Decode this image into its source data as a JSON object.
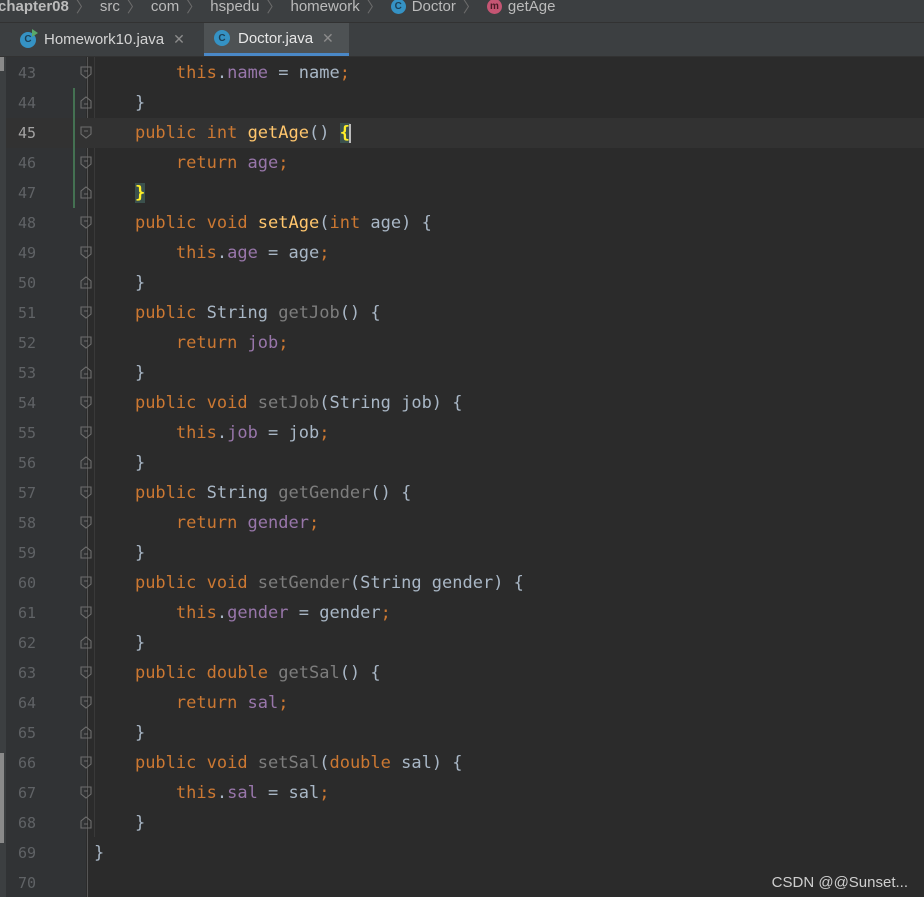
{
  "breadcrumb": {
    "items": [
      {
        "label": "chapter08",
        "icon": null
      },
      {
        "label": "src",
        "icon": null
      },
      {
        "label": "com",
        "icon": null
      },
      {
        "label": "hspedu",
        "icon": null
      },
      {
        "label": "homework",
        "icon": null
      },
      {
        "label": "Doctor",
        "icon": "class-c"
      },
      {
        "label": "getAge",
        "icon": "method-m"
      }
    ]
  },
  "tabs": [
    {
      "label": "Homework10.java",
      "icon": "class-runnable-icon",
      "active": false
    },
    {
      "label": "Doctor.java",
      "icon": "class-icon",
      "active": true
    }
  ],
  "editor": {
    "current_line": 45,
    "lines": [
      {
        "n": "43",
        "tokens": [
          [
            "        ",
            "pl"
          ],
          [
            "this",
            "kw"
          ],
          [
            ".",
            "pl"
          ],
          [
            "name",
            "fld"
          ],
          [
            " = name",
            "pl"
          ],
          [
            ";",
            "kw"
          ]
        ]
      },
      {
        "n": "44",
        "tokens": [
          [
            "    }",
            "pl"
          ]
        ]
      },
      {
        "n": "45",
        "tokens": [
          [
            "    ",
            "pl"
          ],
          [
            "public ",
            "kw"
          ],
          [
            "int ",
            "kw"
          ],
          [
            "getAge",
            "mth"
          ],
          [
            "() ",
            "pl"
          ],
          [
            "{",
            "brace-hl"
          ]
        ]
      },
      {
        "n": "46",
        "tokens": [
          [
            "        ",
            "pl"
          ],
          [
            "return ",
            "kw"
          ],
          [
            "age",
            "fld"
          ],
          [
            ";",
            "kw"
          ]
        ]
      },
      {
        "n": "47",
        "tokens": [
          [
            "    ",
            "pl"
          ],
          [
            "}",
            "brace-hl"
          ]
        ]
      },
      {
        "n": "48",
        "tokens": [
          [
            "    ",
            "pl"
          ],
          [
            "public ",
            "kw"
          ],
          [
            "void ",
            "kw"
          ],
          [
            "setAge",
            "mth"
          ],
          [
            "(",
            "pl"
          ],
          [
            "int ",
            "kw"
          ],
          [
            "age) {",
            "pl"
          ]
        ]
      },
      {
        "n": "49",
        "tokens": [
          [
            "        ",
            "pl"
          ],
          [
            "this",
            "kw"
          ],
          [
            ".",
            "pl"
          ],
          [
            "age",
            "fld"
          ],
          [
            " = age",
            "pl"
          ],
          [
            ";",
            "kw"
          ]
        ]
      },
      {
        "n": "50",
        "tokens": [
          [
            "    }",
            "pl"
          ]
        ]
      },
      {
        "n": "51",
        "tokens": [
          [
            "    ",
            "pl"
          ],
          [
            "public ",
            "kw"
          ],
          [
            "String ",
            "pl"
          ],
          [
            "getJob",
            "mth-dim"
          ],
          [
            "() {",
            "pl"
          ]
        ]
      },
      {
        "n": "52",
        "tokens": [
          [
            "        ",
            "pl"
          ],
          [
            "return ",
            "kw"
          ],
          [
            "job",
            "fld"
          ],
          [
            ";",
            "kw"
          ]
        ]
      },
      {
        "n": "53",
        "tokens": [
          [
            "    }",
            "pl"
          ]
        ]
      },
      {
        "n": "54",
        "tokens": [
          [
            "    ",
            "pl"
          ],
          [
            "public ",
            "kw"
          ],
          [
            "void ",
            "kw"
          ],
          [
            "setJob",
            "mth-dim"
          ],
          [
            "(String job) {",
            "pl"
          ]
        ]
      },
      {
        "n": "55",
        "tokens": [
          [
            "        ",
            "pl"
          ],
          [
            "this",
            "kw"
          ],
          [
            ".",
            "pl"
          ],
          [
            "job",
            "fld"
          ],
          [
            " = job",
            "pl"
          ],
          [
            ";",
            "kw"
          ]
        ]
      },
      {
        "n": "56",
        "tokens": [
          [
            "    }",
            "pl"
          ]
        ]
      },
      {
        "n": "57",
        "tokens": [
          [
            "    ",
            "pl"
          ],
          [
            "public ",
            "kw"
          ],
          [
            "String ",
            "pl"
          ],
          [
            "getGender",
            "mth-dim"
          ],
          [
            "() {",
            "pl"
          ]
        ]
      },
      {
        "n": "58",
        "tokens": [
          [
            "        ",
            "pl"
          ],
          [
            "return ",
            "kw"
          ],
          [
            "gender",
            "fld"
          ],
          [
            ";",
            "kw"
          ]
        ]
      },
      {
        "n": "59",
        "tokens": [
          [
            "    }",
            "pl"
          ]
        ]
      },
      {
        "n": "60",
        "tokens": [
          [
            "    ",
            "pl"
          ],
          [
            "public ",
            "kw"
          ],
          [
            "void ",
            "kw"
          ],
          [
            "setGender",
            "mth-dim"
          ],
          [
            "(String gender) {",
            "pl"
          ]
        ]
      },
      {
        "n": "61",
        "tokens": [
          [
            "        ",
            "pl"
          ],
          [
            "this",
            "kw"
          ],
          [
            ".",
            "pl"
          ],
          [
            "gender",
            "fld"
          ],
          [
            " = gender",
            "pl"
          ],
          [
            ";",
            "kw"
          ]
        ]
      },
      {
        "n": "62",
        "tokens": [
          [
            "    }",
            "pl"
          ]
        ]
      },
      {
        "n": "63",
        "tokens": [
          [
            "    ",
            "pl"
          ],
          [
            "public ",
            "kw"
          ],
          [
            "double ",
            "kw"
          ],
          [
            "getSal",
            "mth-dim"
          ],
          [
            "() {",
            "pl"
          ]
        ]
      },
      {
        "n": "64",
        "tokens": [
          [
            "        ",
            "pl"
          ],
          [
            "return ",
            "kw"
          ],
          [
            "sal",
            "fld"
          ],
          [
            ";",
            "kw"
          ]
        ]
      },
      {
        "n": "65",
        "tokens": [
          [
            "    }",
            "pl"
          ]
        ]
      },
      {
        "n": "66",
        "tokens": [
          [
            "    ",
            "pl"
          ],
          [
            "public ",
            "kw"
          ],
          [
            "void ",
            "kw"
          ],
          [
            "setSal",
            "mth-dim"
          ],
          [
            "(",
            "pl"
          ],
          [
            "double ",
            "kw"
          ],
          [
            "sal) {",
            "pl"
          ]
        ]
      },
      {
        "n": "67",
        "tokens": [
          [
            "        ",
            "pl"
          ],
          [
            "this",
            "kw"
          ],
          [
            ".",
            "pl"
          ],
          [
            "sal",
            "fld"
          ],
          [
            " = sal",
            "pl"
          ],
          [
            ";",
            "kw"
          ]
        ]
      },
      {
        "n": "68",
        "tokens": [
          [
            "    }",
            "pl"
          ]
        ]
      },
      {
        "n": "69",
        "tokens": [
          [
            "}",
            "pl"
          ]
        ]
      },
      {
        "n": "70",
        "tokens": []
      }
    ]
  },
  "watermark": "CSDN @@Sunset...",
  "colors": {
    "keyword": "#cc7832",
    "field": "#9876aa",
    "method_decl": "#ffc66d",
    "plain": "#a9b7c6",
    "background": "#2b2b2b",
    "active_tab_underline": "#4a88c7"
  }
}
